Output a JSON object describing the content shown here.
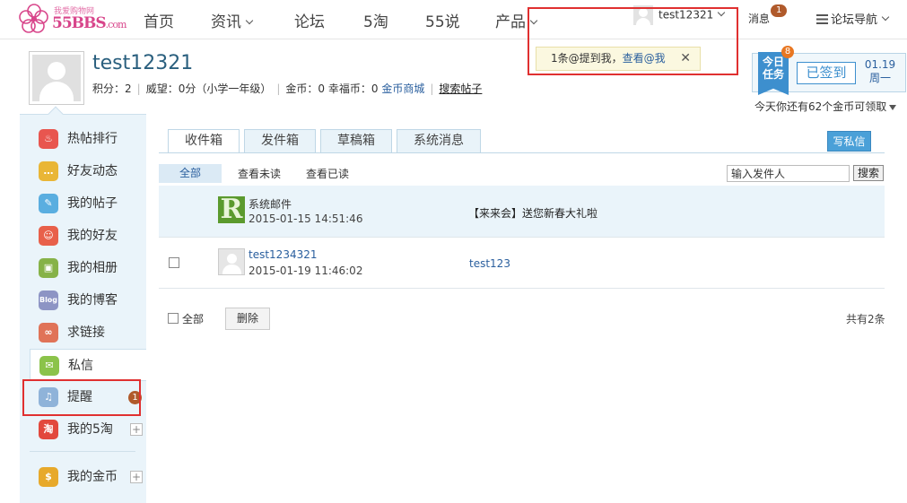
{
  "logo": {
    "tagline": "我爱购物网",
    "brand": "55BBS",
    "brand_suffix": ".com"
  },
  "nav": {
    "items": [
      "首页",
      "资讯",
      "论坛",
      "5淘",
      "55说",
      "产品"
    ],
    "username": "test12321",
    "messages_label": "消息",
    "messages_count": "1",
    "forum_nav_label": "论坛导航"
  },
  "popup": {
    "text": "1条@提到我，",
    "link": "查看@我",
    "close": "✕"
  },
  "profile": {
    "name": "test12321",
    "points_label": "积分：",
    "points": "2",
    "prestige": "威望：0分（小学一年级）",
    "gold": "金币：0",
    "fortune": "幸福币：0",
    "shop_link": "金币商城",
    "search_link": "搜索帖子"
  },
  "task": {
    "label_line1": "今日",
    "label_line2": "任务",
    "badge": "8",
    "signed": "已签到",
    "date": "01.19",
    "weekday": "周一",
    "note": "今天你还有62个金币可领取"
  },
  "sidebar": {
    "items": [
      {
        "label": "热帖排行",
        "icon": "fire-icon",
        "color": "#e8564f",
        "glyph": "♨"
      },
      {
        "label": "好友动态",
        "icon": "chat-bubble-icon",
        "color": "#e9b636",
        "glyph": "…"
      },
      {
        "label": "我的帖子",
        "icon": "edit-icon",
        "color": "#5aaee0",
        "glyph": "✎"
      },
      {
        "label": "我的好友",
        "icon": "friends-icon",
        "color": "#e8604a",
        "glyph": "☺"
      },
      {
        "label": "我的相册",
        "icon": "album-icon",
        "color": "#86b248",
        "glyph": "▣"
      },
      {
        "label": "我的博客",
        "icon": "blog-icon",
        "color": "#8d94c4",
        "glyph": "Blog"
      },
      {
        "label": "求链接",
        "icon": "link-icon",
        "color": "#e07358",
        "glyph": "∞"
      },
      {
        "label": "私信",
        "icon": "mail-icon",
        "color": "#8bc34a",
        "glyph": "✉"
      },
      {
        "label": "提醒",
        "icon": "bell-icon",
        "color": "#8fb3d9",
        "glyph": "♫",
        "badge": "1"
      },
      {
        "label": "我的5淘",
        "icon": "tao-icon",
        "color": "#e2483d",
        "glyph": "淘",
        "plus": "+"
      },
      {
        "label": "我的金币",
        "icon": "coin-icon",
        "color": "#e7a92b",
        "glyph": "$",
        "plus": "+"
      }
    ]
  },
  "tabs": [
    "收件箱",
    "发件箱",
    "草稿箱",
    "系统消息"
  ],
  "write_button": "写私信",
  "filters": {
    "all": "全部",
    "unread": "查看未读",
    "read": "查看已读"
  },
  "search": {
    "placeholder": "输入发件人",
    "button": "搜索"
  },
  "messages": [
    {
      "sender": "系统邮件",
      "time": "2015-01-15 14:51:46",
      "subject": "【来来会】送您新春大礼啦",
      "avatar_glyph": "R"
    },
    {
      "sender": "test1234321",
      "time": "2015-01-19 11:46:02",
      "subject": "test123"
    }
  ],
  "footer": {
    "select_all": "全部",
    "delete": "删除",
    "total": "共有2条"
  },
  "colors": {
    "accent": "#3d8fce",
    "link": "#2a5f9e",
    "highlight_frame": "#e03030",
    "badge": "#b05a2b"
  }
}
